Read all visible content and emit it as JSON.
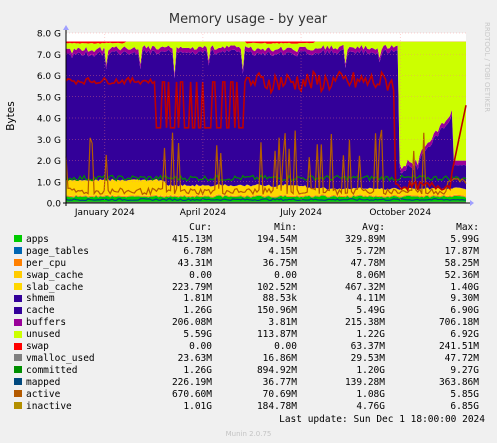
{
  "chart_data": {
    "type": "area",
    "title": "Memory usage - by year",
    "ylabel": "Bytes",
    "xlabel": "",
    "ylim": [
      0,
      8000000000
    ],
    "y_ticks": [
      "0.0",
      "1.0 G",
      "2.0 G",
      "3.0 G",
      "4.0 G",
      "5.0 G",
      "6.0 G",
      "7.0 G",
      "8.0 G"
    ],
    "y_tick_values": [
      0,
      1000000000,
      2000000000,
      3000000000,
      4000000000,
      5000000000,
      6000000000,
      7000000000,
      8000000000
    ],
    "x_range": [
      "2023-11-26",
      "2024-12-01"
    ],
    "x_ticks": [
      {
        "label": "January 2024",
        "date": "2024-01-01"
      },
      {
        "label": "April 2024",
        "date": "2024-04-01"
      },
      {
        "label": "July 2024",
        "date": "2024-07-01"
      },
      {
        "label": "October 2024",
        "date": "2024-10-01"
      }
    ],
    "grid": true,
    "watermark": "RRDTOOL / TOBI OETIKER",
    "approximate_total_gb": 7.6,
    "series": [
      {
        "name": "apps",
        "color": "#00cc00",
        "kind": "stack",
        "approx_gb": 0.33
      },
      {
        "name": "page_tables",
        "color": "#0066b3",
        "kind": "stack",
        "approx_gb": 0.006
      },
      {
        "name": "per_cpu",
        "color": "#ff8000",
        "kind": "stack",
        "approx_gb": 0.05
      },
      {
        "name": "swap_cache",
        "color": "#ffcc00",
        "kind": "stack",
        "approx_gb": 0.008
      },
      {
        "name": "slab_cache",
        "color": "#ffd700",
        "kind": "stack",
        "approx_gb": 0.47
      },
      {
        "name": "shmem",
        "color": "#330099",
        "kind": "stack",
        "approx_gb": 0.004
      },
      {
        "name": "cache",
        "color": "#330099",
        "kind": "stack",
        "approx_gb": 5.49
      },
      {
        "name": "buffers",
        "color": "#990099",
        "kind": "stack",
        "approx_gb": 0.21
      },
      {
        "name": "unused",
        "color": "#ccff00",
        "kind": "stack",
        "approx_gb": 1.22
      },
      {
        "name": "swap",
        "color": "#ff0000",
        "kind": "stack",
        "approx_gb": 0.06
      },
      {
        "name": "vmalloc_used",
        "color": "#808080",
        "kind": "line",
        "approx_gb": 0.03
      },
      {
        "name": "committed",
        "color": "#008f00",
        "kind": "line",
        "approx_gb": 1.2
      },
      {
        "name": "mapped",
        "color": "#00487d",
        "kind": "line",
        "approx_gb": 0.14
      },
      {
        "name": "active",
        "color": "#b35a00",
        "kind": "line",
        "approx_gb": 1.08
      },
      {
        "name": "inactive",
        "color": "#b38f00",
        "kind": "line",
        "approx_gb": 4.76
      }
    ]
  },
  "legend": {
    "headers": {
      "cur": "Cur:",
      "min": "Min:",
      "avg": "Avg:",
      "max": "Max:"
    },
    "rows": [
      {
        "name": "apps",
        "color": "#00cc00",
        "cur": "415.13M",
        "min": "194.54M",
        "avg": "329.89M",
        "max": "5.99G"
      },
      {
        "name": "page_tables",
        "color": "#0066b3",
        "cur": "6.78M",
        "min": "4.15M",
        "avg": "5.72M",
        "max": "17.87M"
      },
      {
        "name": "per_cpu",
        "color": "#ff8000",
        "cur": "43.31M",
        "min": "36.75M",
        "avg": "47.78M",
        "max": "58.25M"
      },
      {
        "name": "swap_cache",
        "color": "#ffcc00",
        "cur": "0.00",
        "min": "0.00",
        "avg": "8.06M",
        "max": "52.36M"
      },
      {
        "name": "slab_cache",
        "color": "#ffd700",
        "cur": "223.79M",
        "min": "102.52M",
        "avg": "467.32M",
        "max": "1.40G"
      },
      {
        "name": "shmem",
        "color": "#330099",
        "cur": "1.81M",
        "min": "88.53k",
        "avg": "4.11M",
        "max": "9.30M"
      },
      {
        "name": "cache",
        "color": "#330099",
        "cur": "1.26G",
        "min": "150.96M",
        "avg": "5.49G",
        "max": "6.90G"
      },
      {
        "name": "buffers",
        "color": "#990099",
        "cur": "206.08M",
        "min": "3.81M",
        "avg": "215.38M",
        "max": "706.18M"
      },
      {
        "name": "unused",
        "color": "#ccff00",
        "cur": "5.59G",
        "min": "113.87M",
        "avg": "1.22G",
        "max": "6.92G"
      },
      {
        "name": "swap",
        "color": "#ff0000",
        "cur": "0.00",
        "min": "0.00",
        "avg": "63.37M",
        "max": "241.51M"
      },
      {
        "name": "vmalloc_used",
        "color": "#808080",
        "cur": "23.63M",
        "min": "16.86M",
        "avg": "29.53M",
        "max": "47.72M"
      },
      {
        "name": "committed",
        "color": "#008f00",
        "cur": "1.26G",
        "min": "894.92M",
        "avg": "1.20G",
        "max": "9.27G"
      },
      {
        "name": "mapped",
        "color": "#00487d",
        "cur": "226.19M",
        "min": "36.77M",
        "avg": "139.28M",
        "max": "363.86M"
      },
      {
        "name": "active",
        "color": "#b35a00",
        "cur": "670.60M",
        "min": "70.69M",
        "avg": "1.08G",
        "max": "5.85G"
      },
      {
        "name": "inactive",
        "color": "#b38f00",
        "cur": "1.01G",
        "min": "184.78M",
        "avg": "4.76G",
        "max": "6.85G"
      }
    ]
  },
  "footer": {
    "last_update": "Last update: Sun Dec  1 18:00:00 2024",
    "munin": "Munin 2.0.75"
  }
}
